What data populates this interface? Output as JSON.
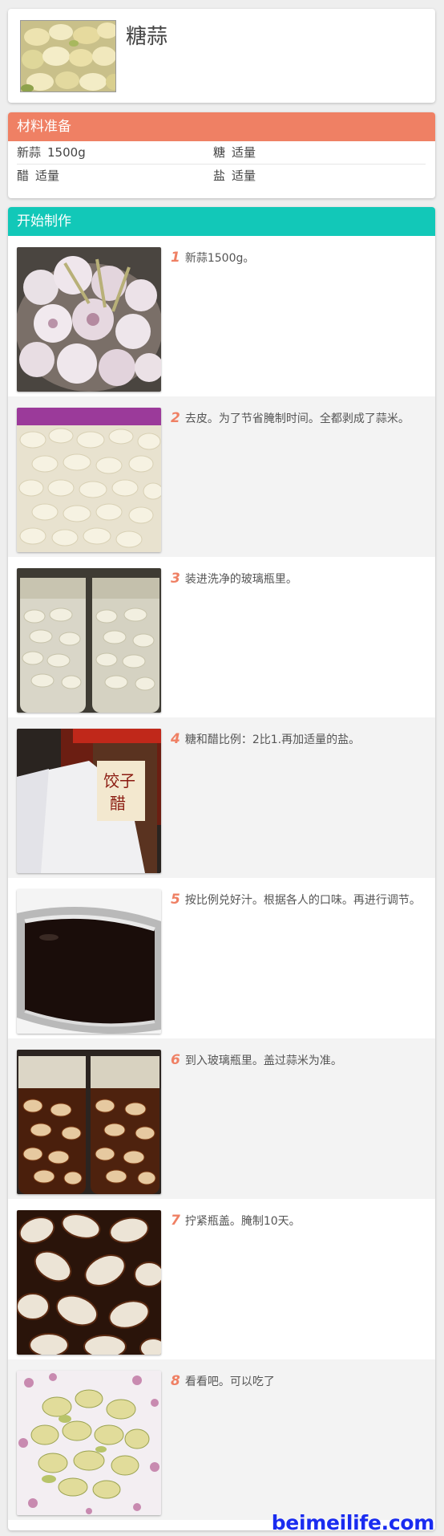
{
  "recipe": {
    "title": "糖蒜"
  },
  "ingredients": {
    "header": "材料准备",
    "rows": [
      [
        {
          "name": "新蒜",
          "amount": "1500g"
        },
        {
          "name": "糖",
          "amount": "适量"
        }
      ],
      [
        {
          "name": "醋",
          "amount": "适量"
        },
        {
          "name": "盐",
          "amount": "适量"
        }
      ]
    ]
  },
  "steps": {
    "header": "开始制作",
    "items": [
      {
        "num": "1",
        "text": "新蒜1500g。"
      },
      {
        "num": "2",
        "text": "去皮。为了节省腌制时间。全都剥成了蒜米。"
      },
      {
        "num": "3",
        "text": "装进洗净的玻璃瓶里。"
      },
      {
        "num": "4",
        "text": "糖和醋比例：2比1.再加适量的盐。"
      },
      {
        "num": "5",
        "text": "按比例兑好汁。根据各人的口味。再进行调节。"
      },
      {
        "num": "6",
        "text": "到入玻璃瓶里。盖过蒜米为准。"
      },
      {
        "num": "7",
        "text": "拧紧瓶盖。腌制10天。"
      },
      {
        "num": "8",
        "text": "看看吧。可以吃了"
      }
    ]
  },
  "watermark": "beimeilife.com",
  "colors": {
    "ingredients_header": "#ef8064",
    "steps_header": "#12c8b8",
    "step_number": "#ef8064",
    "watermark": "#1a2cf0"
  }
}
